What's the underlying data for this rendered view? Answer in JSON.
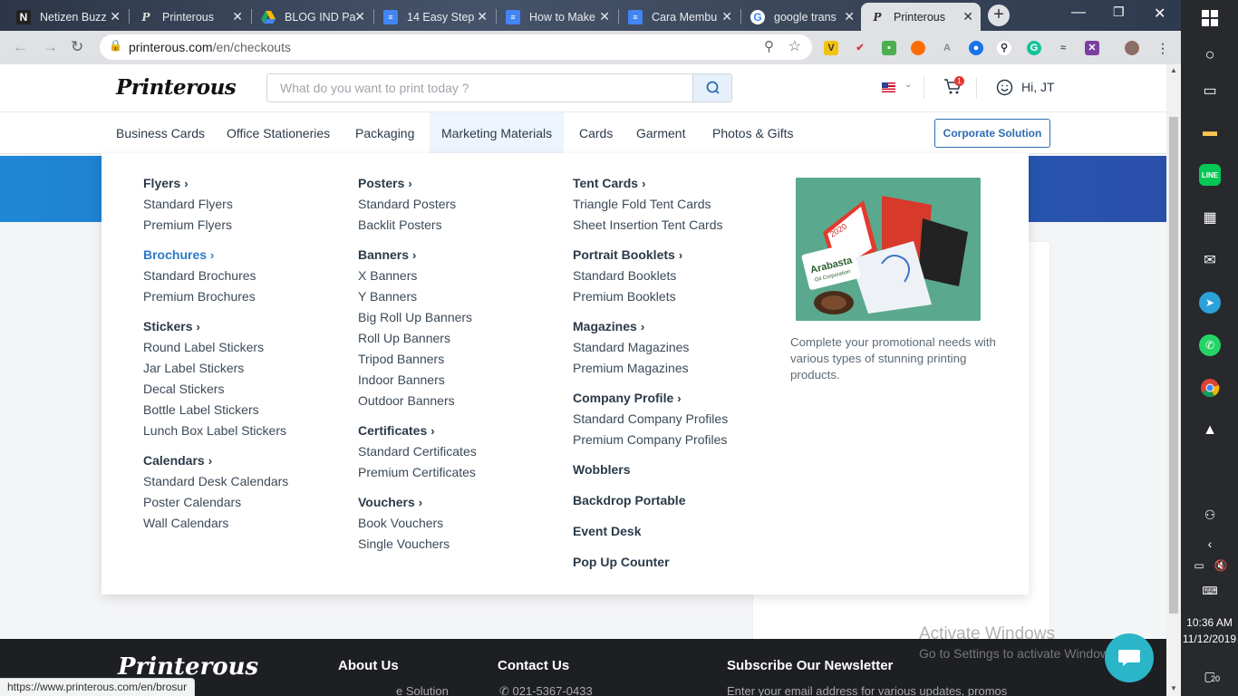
{
  "browser": {
    "tabs": [
      {
        "label": "Netizen Buzz",
        "icon": "netizen-favicon"
      },
      {
        "label": "Printerous",
        "icon": "printerous-favicon"
      },
      {
        "label": "BLOG IND Pa",
        "icon": "google-drive-favicon"
      },
      {
        "label": "14 Easy Step",
        "icon": "google-docs-favicon"
      },
      {
        "label": "How to Make",
        "icon": "google-docs-favicon"
      },
      {
        "label": "Cara Membu",
        "icon": "google-docs-favicon"
      },
      {
        "label": "google trans",
        "icon": "google-favicon"
      },
      {
        "label": "Printerous",
        "icon": "printerous-favicon",
        "active": true
      }
    ],
    "url_domain": "printerous.com",
    "url_path": "/en/checkouts",
    "status_url": "https://www.printerous.com/en/brosur"
  },
  "header": {
    "logo": "Printerous",
    "search_placeholder": "What do you want to print today ?",
    "cart_count": "1",
    "greeting": "Hi, JT"
  },
  "nav": {
    "categories": [
      "Business Cards",
      "Office Stationeries",
      "Packaging",
      "Marketing Materials",
      "Cards",
      "Garment",
      "Photos & Gifts"
    ],
    "active": "Marketing Materials",
    "corporate_button": "Corporate Solution"
  },
  "mega_menu": {
    "col1": [
      {
        "title": "Flyers",
        "items": [
          "Standard Flyers",
          "Premium Flyers"
        ]
      },
      {
        "title": "Brochures",
        "highlighted": true,
        "items": [
          "Standard Brochures",
          "Premium Brochures"
        ]
      },
      {
        "title": "Stickers",
        "items": [
          "Round Label Stickers",
          "Jar Label Stickers",
          "Decal Stickers",
          "Bottle Label Stickers",
          "Lunch Box Label Stickers"
        ]
      },
      {
        "title": "Calendars",
        "items": [
          "Standard Desk Calendars",
          "Poster Calendars",
          "Wall Calendars"
        ]
      }
    ],
    "col2": [
      {
        "title": "Posters",
        "items": [
          "Standard Posters",
          "Backlit Posters"
        ]
      },
      {
        "title": "Banners",
        "items": [
          "X Banners",
          "Y Banners",
          "Big Roll Up Banners",
          "Roll Up Banners",
          "Tripod Banners",
          "Indoor Banners",
          "Outdoor Banners"
        ]
      },
      {
        "title": "Certificates",
        "items": [
          "Standard Certificates",
          "Premium Certificates"
        ]
      },
      {
        "title": "Vouchers",
        "items": [
          "Book Vouchers",
          "Single Vouchers"
        ]
      }
    ],
    "col3": [
      {
        "title": "Tent Cards",
        "items": [
          "Triangle Fold Tent Cards",
          "Sheet Insertion Tent Cards"
        ]
      },
      {
        "title": "Portrait Booklets",
        "items": [
          "Standard Booklets",
          "Premium Booklets"
        ]
      },
      {
        "title": "Magazines",
        "items": [
          "Standard Magazines",
          "Premium Magazines"
        ]
      },
      {
        "title": "Company Profile",
        "items": [
          "Standard Company Profiles",
          "Premium Company Profiles"
        ]
      }
    ],
    "col3_single": [
      "Wobblers",
      "Backdrop Portable",
      "Event Desk",
      "Pop Up Counter"
    ],
    "promo_text": "Complete your promotional needs with various types of stunning printing products.",
    "promo_image_text": {
      "year": "2020",
      "brand": "Arabasta",
      "sub": "Oil Corporation"
    }
  },
  "footer": {
    "logo": "Printerous",
    "about": "About Us",
    "about_sub": "e Solution",
    "contact": "Contact Us",
    "phone": "021-5367-0433",
    "newsletter": "Subscribe Our Newsletter",
    "newsletter_sub": "Enter your email address for various updates, promos"
  },
  "watermark": {
    "line1": "Activate Windows",
    "line2": "Go to Settings to activate Windows."
  },
  "taskbar": {
    "time": "10:36 AM",
    "date": "11/12/2019",
    "notifications": "20"
  },
  "colors": {
    "brand_blue": "#2b6cb0",
    "highlight": "#2b7bc9",
    "banner": "#1e88d6"
  }
}
